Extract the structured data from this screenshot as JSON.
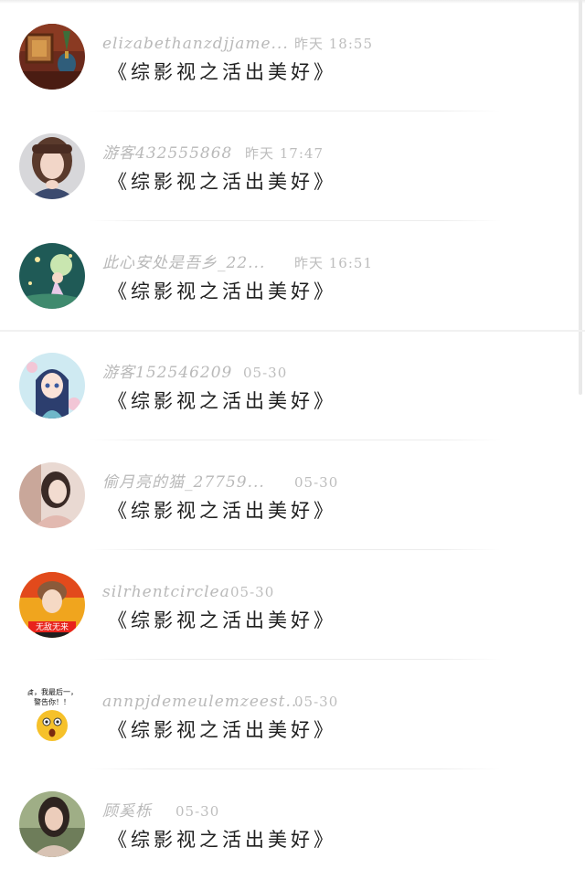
{
  "comments": [
    {
      "user": "elizabethanzdjjame...",
      "time": "昨天 18:55",
      "text": "《综影视之活出美好》",
      "avatar": "lantern-avatar"
    },
    {
      "user": "游客432555868",
      "time": "昨天 17:47",
      "text": "《综影视之活出美好》",
      "avatar": "girl-avatar"
    },
    {
      "user": "此心安处是吾乡_22...",
      "time": "昨天 16:51",
      "text": "《综影视之活出美好》",
      "avatar": "fairy-avatar"
    },
    {
      "user": "游客152546209",
      "time": "05-30",
      "text": "《综影视之活出美好》",
      "avatar": "anime-girl-avatar"
    },
    {
      "user": "偷月亮的猫_27759...",
      "time": "05-30",
      "text": "《综影视之活出美好》",
      "avatar": "woman-photo-avatar"
    },
    {
      "user": "silrhentcirclea",
      "time": "05-30",
      "text": "《综影视之活出美好》",
      "avatar": "idol-avatar"
    },
    {
      "user": "annpjdemeulemzeest...",
      "time": "05-30",
      "text": "《综影视之活出美好》",
      "avatar": "emoji-meme-avatar"
    },
    {
      "user": "顾奚栎",
      "time": "05-30",
      "text": "《综影视之活出美好》",
      "avatar": "portrait-avatar"
    }
  ],
  "avatar_labels": {
    "idol_badge": "无敌无来",
    "meme_line1": "食，我最后一，",
    "meme_line2": "警告你！！"
  }
}
